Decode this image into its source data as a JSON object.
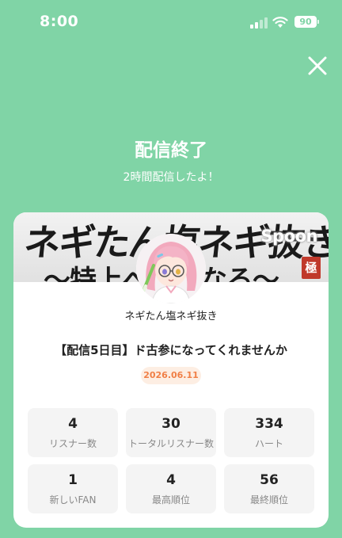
{
  "status_bar": {
    "time": "8:00",
    "battery": "90"
  },
  "header": {
    "title": "配信終了",
    "subtitle": "2時間配信したよ！"
  },
  "card": {
    "banner_text": "ネギたん塩ネギ抜き",
    "banner_sub": "〜特上ぺ　になる〜",
    "banner_brand": "Spoon",
    "banner_seal": "極",
    "broadcaster_name": "ネギたん塩ネギ抜き",
    "stream_title": "【配信5日目】ド古参になってくれませんか",
    "date": "2026.06.11",
    "stats": [
      {
        "value": "4",
        "label": "リスナー数"
      },
      {
        "value": "30",
        "label": "トータルリスナー数"
      },
      {
        "value": "334",
        "label": "ハート"
      },
      {
        "value": "1",
        "label": "新しいFAN"
      },
      {
        "value": "4",
        "label": "最高順位"
      },
      {
        "value": "56",
        "label": "最終順位"
      }
    ]
  },
  "colors": {
    "background": "#80d4a6",
    "date_badge_text": "#f07f46",
    "date_badge_bg": "#fdeee3"
  },
  "icons": {
    "close": "close-icon",
    "wifi": "wifi-icon",
    "signal": "signal-icon",
    "battery": "battery-icon"
  }
}
